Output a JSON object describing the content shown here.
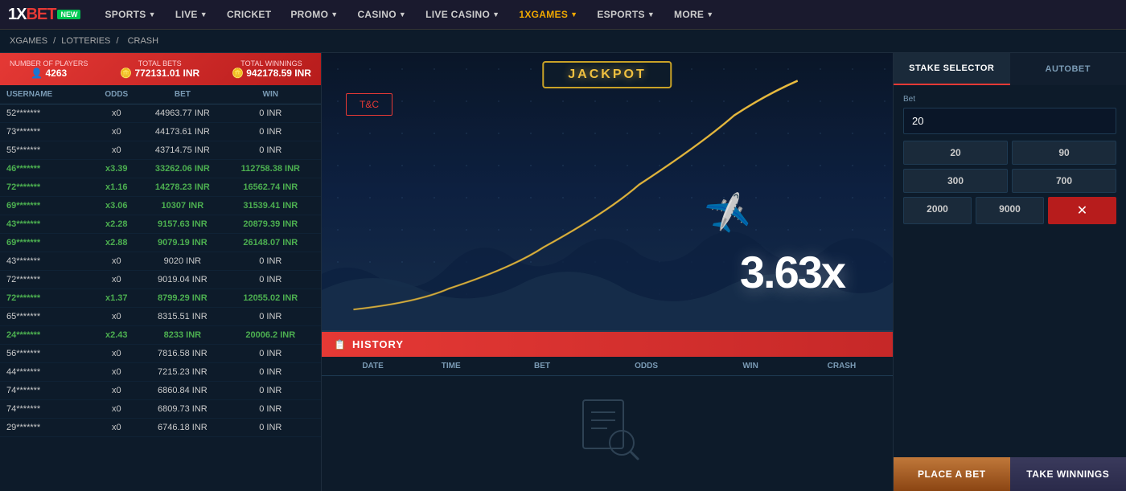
{
  "nav": {
    "logo_1x": "1X",
    "logo_bet": "BET",
    "logo_new": "NEW",
    "items": [
      {
        "label": "SPORTS",
        "arrow": "▼",
        "active": false
      },
      {
        "label": "LIVE",
        "arrow": "▼",
        "active": false
      },
      {
        "label": "CRICKET",
        "arrow": "",
        "active": false
      },
      {
        "label": "PROMO",
        "arrow": "▼",
        "active": false
      },
      {
        "label": "CASINO",
        "arrow": "▼",
        "active": false
      },
      {
        "label": "LIVE CASINO",
        "arrow": "▼",
        "active": false
      },
      {
        "label": "1XGAMES",
        "arrow": "▼",
        "active": true
      },
      {
        "label": "ESPORTS",
        "arrow": "▼",
        "active": false
      },
      {
        "label": "MORE",
        "arrow": "▼",
        "active": false
      }
    ]
  },
  "breadcrumb": {
    "items": [
      "XGAMES",
      "LOTTERIES",
      "CRASH"
    ]
  },
  "stats": {
    "players_label": "Number of players",
    "players_value": "4263",
    "bets_label": "Total bets",
    "bets_value": "772131.01 INR",
    "winnings_label": "Total winnings",
    "winnings_value": "942178.59 INR"
  },
  "table": {
    "headers": [
      "USERNAME",
      "ODDS",
      "BET",
      "WIN"
    ],
    "rows": [
      {
        "username": "52*******",
        "odds": "x0",
        "bet": "44963.77 INR",
        "win": "0 INR",
        "won": false
      },
      {
        "username": "73*******",
        "odds": "x0",
        "bet": "44173.61 INR",
        "win": "0 INR",
        "won": false
      },
      {
        "username": "55*******",
        "odds": "x0",
        "bet": "43714.75 INR",
        "win": "0 INR",
        "won": false
      },
      {
        "username": "46*******",
        "odds": "x3.39",
        "bet": "33262.06 INR",
        "win": "112758.38 INR",
        "won": true
      },
      {
        "username": "72*******",
        "odds": "x1.16",
        "bet": "14278.23 INR",
        "win": "16562.74 INR",
        "won": true
      },
      {
        "username": "69*******",
        "odds": "x3.06",
        "bet": "10307 INR",
        "win": "31539.41 INR",
        "won": true
      },
      {
        "username": "43*******",
        "odds": "x2.28",
        "bet": "9157.63 INR",
        "win": "20879.39 INR",
        "won": true
      },
      {
        "username": "69*******",
        "odds": "x2.88",
        "bet": "9079.19 INR",
        "win": "26148.07 INR",
        "won": true
      },
      {
        "username": "43*******",
        "odds": "x0",
        "bet": "9020 INR",
        "win": "0 INR",
        "won": false
      },
      {
        "username": "72*******",
        "odds": "x0",
        "bet": "9019.04 INR",
        "win": "0 INR",
        "won": false
      },
      {
        "username": "72*******",
        "odds": "x1.37",
        "bet": "8799.29 INR",
        "win": "12055.02 INR",
        "won": true
      },
      {
        "username": "65*******",
        "odds": "x0",
        "bet": "8315.51 INR",
        "win": "0 INR",
        "won": false
      },
      {
        "username": "24*******",
        "odds": "x2.43",
        "bet": "8233 INR",
        "win": "20006.2 INR",
        "won": true
      },
      {
        "username": "56*******",
        "odds": "x0",
        "bet": "7816.58 INR",
        "win": "0 INR",
        "won": false
      },
      {
        "username": "44*******",
        "odds": "x0",
        "bet": "7215.23 INR",
        "win": "0 INR",
        "won": false
      },
      {
        "username": "74*******",
        "odds": "x0",
        "bet": "6860.84 INR",
        "win": "0 INR",
        "won": false
      },
      {
        "username": "74*******",
        "odds": "x0",
        "bet": "6809.73 INR",
        "win": "0 INR",
        "won": false
      },
      {
        "username": "29*******",
        "odds": "x0",
        "bet": "6746.18 INR",
        "win": "0 INR",
        "won": false
      }
    ]
  },
  "jackpot": {
    "text": "JACKPOT"
  },
  "game": {
    "tc_button": "T&C",
    "multiplier": "3.63x"
  },
  "history": {
    "title": "HISTORY",
    "headers": [
      "DATE",
      "TIME",
      "BET",
      "ODDS",
      "WIN",
      "CRASH"
    ]
  },
  "stake": {
    "selector_tab": "STAKE SELECTOR",
    "autobet_tab": "AUTOBET",
    "bet_label": "Bet",
    "bet_value": "20",
    "quick_bets": [
      "20",
      "90",
      "300",
      "700"
    ],
    "quick_bets_2": [
      "2000",
      "9000"
    ],
    "place_bet": "PLACE A BET",
    "take_winnings": "TAKE WINNINGS"
  }
}
